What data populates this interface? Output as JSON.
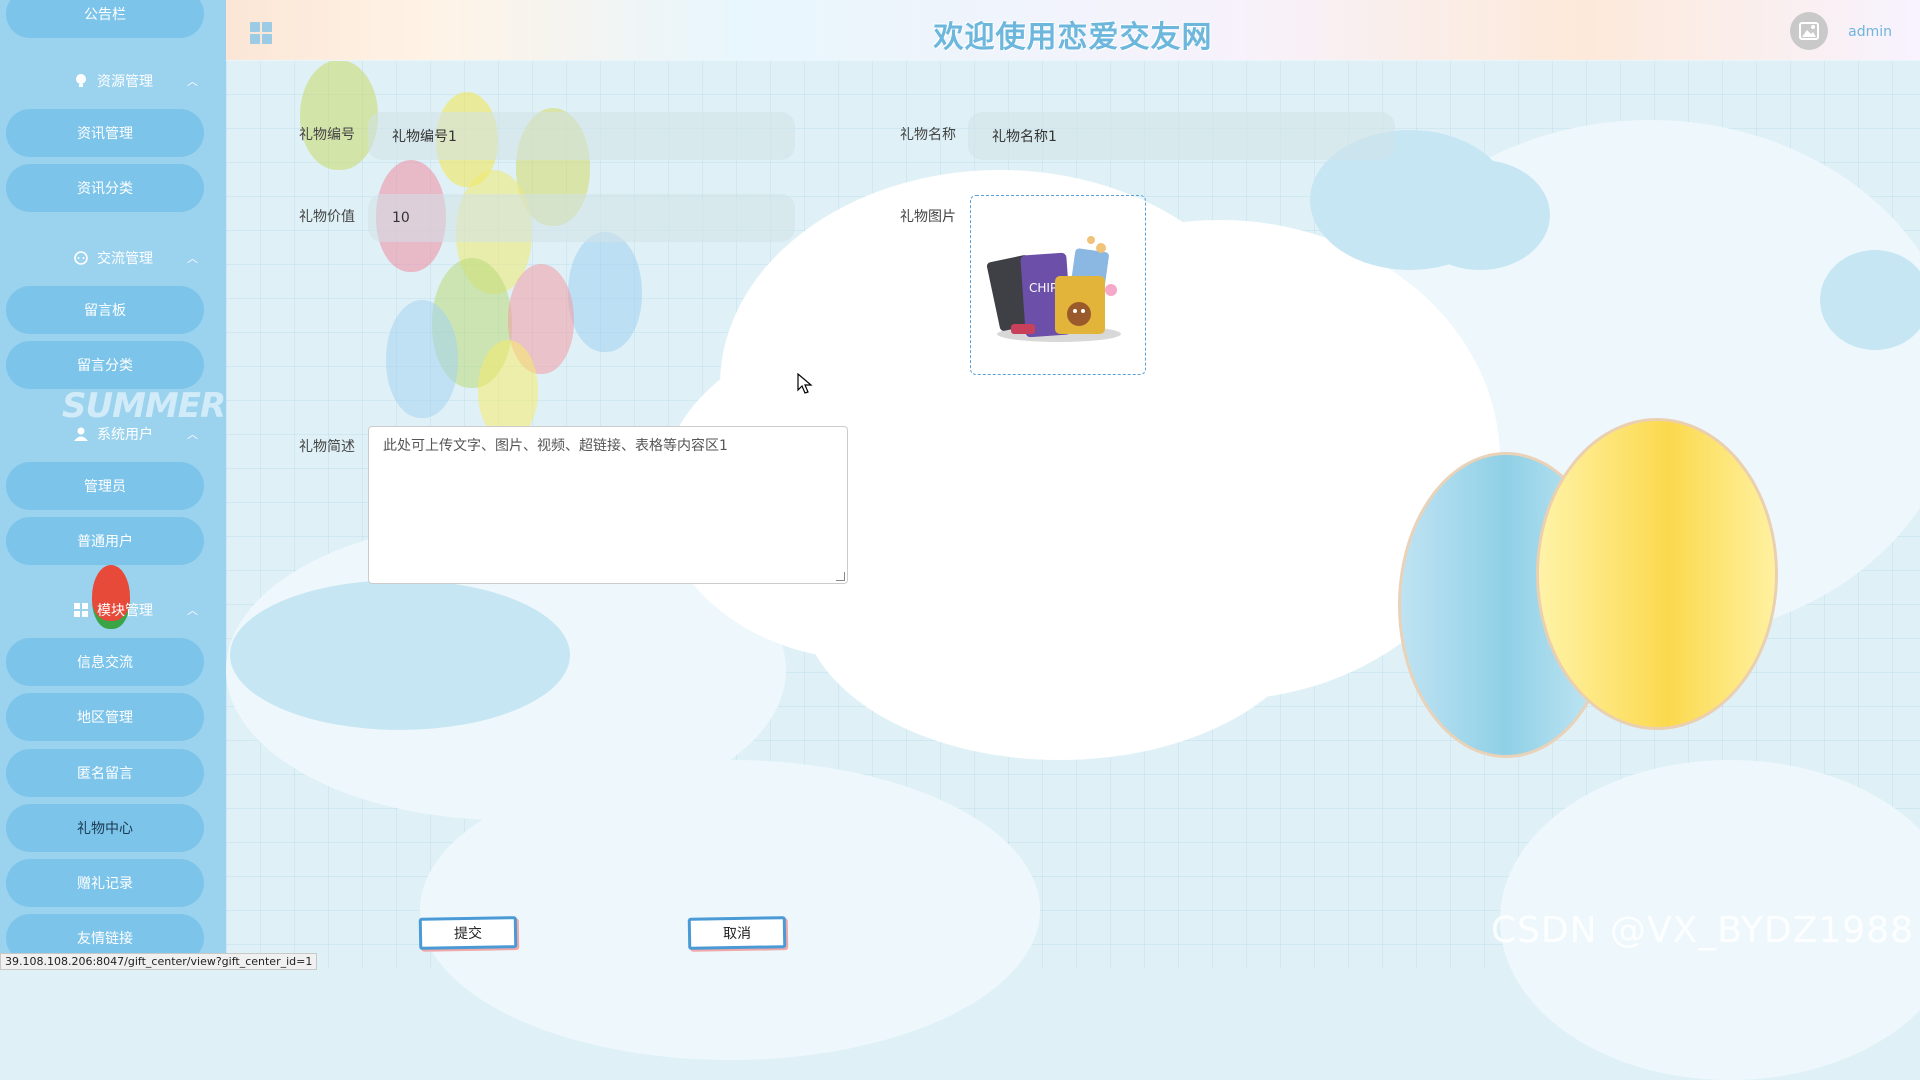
{
  "header": {
    "title": "欢迎使用恋爱交友网",
    "username": "admin"
  },
  "sidebar": {
    "top_item": "公告栏",
    "summer_text": "SUMMER",
    "groups": [
      {
        "title": "资源管理",
        "icon": "bulb-icon",
        "items": [
          "资讯管理",
          "资讯分类"
        ]
      },
      {
        "title": "交流管理",
        "icon": "chat-icon",
        "items": [
          "留言板",
          "留言分类"
        ]
      },
      {
        "title": "系统用户",
        "icon": "user-icon",
        "items": [
          "管理员",
          "普通用户"
        ]
      },
      {
        "title": "模块管理",
        "icon": "grid-icon",
        "items": [
          "信息交流",
          "地区管理",
          "匿名留言",
          "礼物中心",
          "赠礼记录",
          "友情链接"
        ]
      }
    ],
    "active_item": "礼物中心"
  },
  "form": {
    "gift_no_label": "礼物编号",
    "gift_no_value": "礼物编号1",
    "gift_name_label": "礼物名称",
    "gift_name_value": "礼物名称1",
    "gift_value_label": "礼物价值",
    "gift_value_value": "10",
    "gift_image_label": "礼物图片",
    "gift_desc_label": "礼物简述",
    "gift_desc_value": "此处可上传文字、图片、视频、超链接、表格等内容区1",
    "submit_label": "提交",
    "cancel_label": "取消"
  },
  "statusbar": {
    "url": "39.108.108.206:8047/gift_center/view?gift_center_id=1"
  },
  "watermark": "CSDN @VX_BYDZ1988",
  "colors": {
    "sidebar": "#9bd3ef",
    "pill": "#7cc4ea",
    "title": "#6db7dd",
    "accent": "#5aa0d8"
  }
}
